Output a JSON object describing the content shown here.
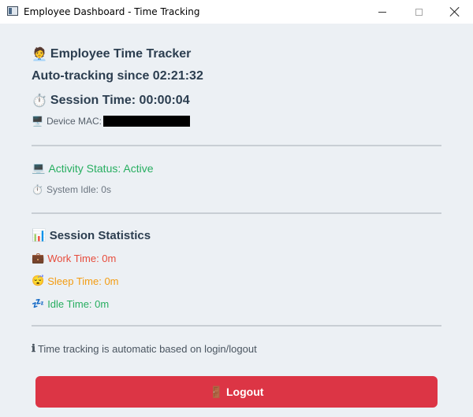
{
  "window": {
    "title": "Employee Dashboard - Time Tracking"
  },
  "header": {
    "title_icon": "🧑‍💼",
    "title": "Employee Time Tracker",
    "auto_tracking": "Auto-tracking since 02:21:32",
    "session_icon": "⏱️",
    "session_time": "Session Time: 00:00:04",
    "device_icon": "🖥️",
    "device_mac_label": "Device MAC:"
  },
  "activity": {
    "status_icon": "💻",
    "status": "Activity Status: Active",
    "idle_icon": "⏱️",
    "system_idle": "System Idle: 0s"
  },
  "stats": {
    "icon": "📊",
    "title": "Session Statistics",
    "work_icon": "💼",
    "work": "Work Time: 0m",
    "sleep_icon": "😴",
    "sleep": "Sleep Time: 0m",
    "idle_icon": "💤",
    "idle": "Idle Time: 0m"
  },
  "info": {
    "icon": "ℹ",
    "text": "Time tracking is automatic based on login/logout"
  },
  "logout": {
    "icon": "🚪",
    "label": "Logout"
  },
  "colors": {
    "active_green": "#27ae60",
    "work_red": "#e74c3c",
    "sleep_orange": "#f39c12",
    "logout_red": "#dc3545",
    "heading": "#2c3e50"
  }
}
